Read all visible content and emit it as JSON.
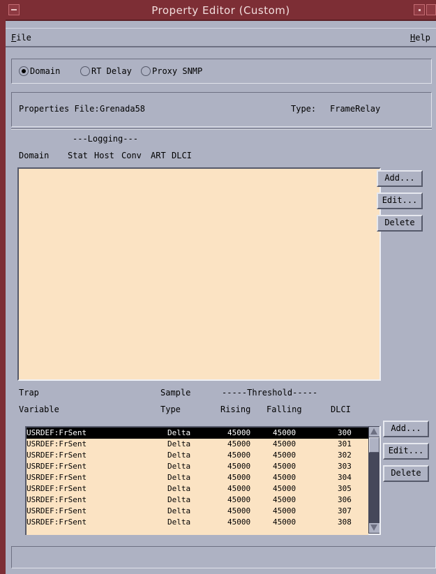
{
  "window": {
    "title": "Property Editor (Custom)"
  },
  "menubar": {
    "file": "File",
    "file_rest": "ile",
    "file_key": "F",
    "help_key": "H",
    "help_rest": "elp"
  },
  "radios": [
    {
      "label": "Domain",
      "selected": true
    },
    {
      "label": "RT Delay",
      "selected": false
    },
    {
      "label": "Proxy SNMP",
      "selected": false
    }
  ],
  "properties": {
    "file_label": "Properties File:",
    "file_value": "Grenada58",
    "type_label": "Type:",
    "type_value": "FrameRelay"
  },
  "domain_section": {
    "group_header": "---Logging---",
    "columns": [
      "Domain",
      "Stat",
      "Host",
      "Conv",
      "ART",
      "DLCI"
    ],
    "buttons": {
      "add": "Add...",
      "edit": "Edit...",
      "delete": "Delete"
    }
  },
  "trap_section": {
    "header1": {
      "trap": "Trap",
      "sample": "Sample",
      "threshold": "-----Threshold-----"
    },
    "header2": {
      "variable": "Variable",
      "type": "Type",
      "rising": "Rising",
      "falling": "Falling",
      "dlci": "DLCI"
    },
    "rows": [
      [
        "USRDEF:FrSent",
        "Delta",
        "45000",
        "45000",
        "300"
      ],
      [
        "USRDEF:FrSent",
        "Delta",
        "45000",
        "45000",
        "301"
      ],
      [
        "USRDEF:FrSent",
        "Delta",
        "45000",
        "45000",
        "302"
      ],
      [
        "USRDEF:FrSent",
        "Delta",
        "45000",
        "45000",
        "303"
      ],
      [
        "USRDEF:FrSent",
        "Delta",
        "45000",
        "45000",
        "304"
      ],
      [
        "USRDEF:FrSent",
        "Delta",
        "45000",
        "45000",
        "305"
      ],
      [
        "USRDEF:FrSent",
        "Delta",
        "45000",
        "45000",
        "306"
      ],
      [
        "USRDEF:FrSent",
        "Delta",
        "45000",
        "45000",
        "307"
      ],
      [
        "USRDEF:FrSent",
        "Delta",
        "45000",
        "45000",
        "308"
      ]
    ],
    "selected_row": 0,
    "buttons": {
      "add": "Add...",
      "edit": "Edit...",
      "delete": "Delete"
    }
  },
  "colors": {
    "titlebar": "#7d2e35",
    "list_bg": "#fbe3c3",
    "window_bg": "#aeb2c3"
  }
}
